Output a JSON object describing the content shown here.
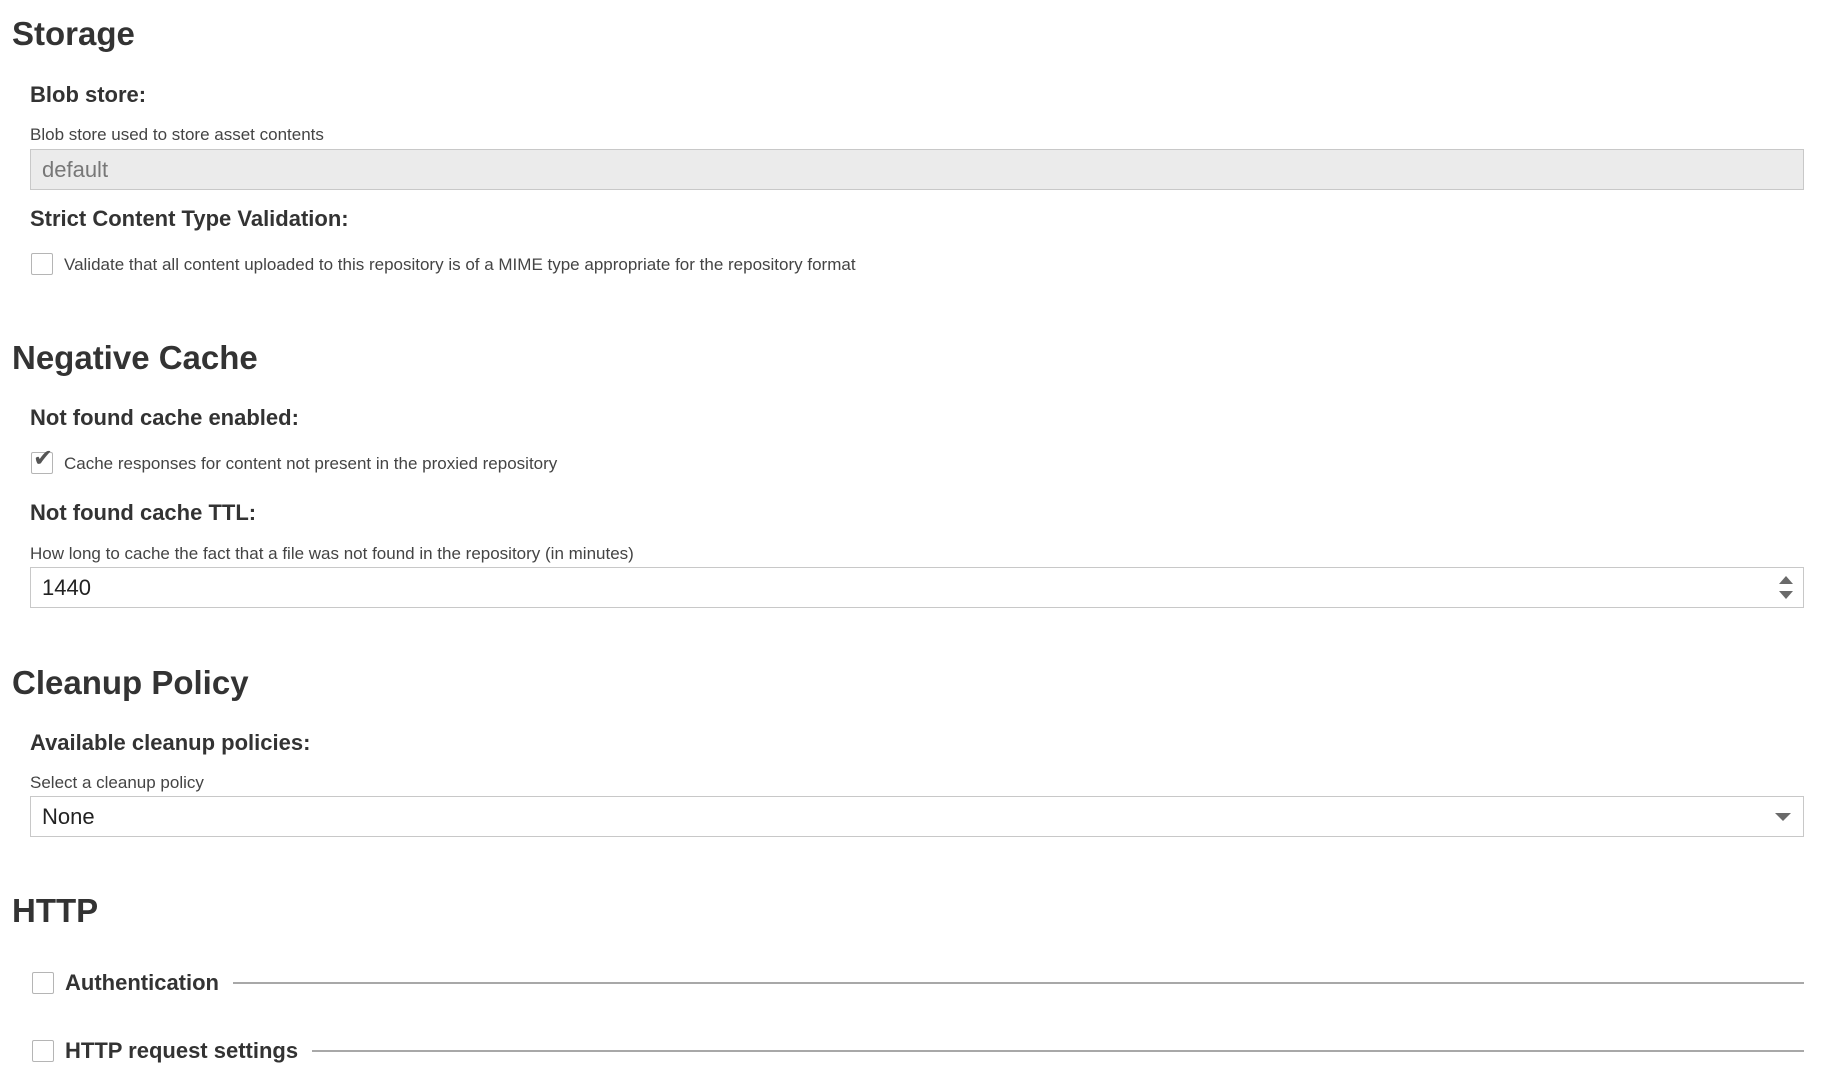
{
  "storage": {
    "title": "Storage",
    "blob_store": {
      "label": "Blob store:",
      "help": "Blob store used to store asset contents",
      "value": "default"
    },
    "strict_content": {
      "label": "Strict Content Type Validation:",
      "checkbox_label": "Validate that all content uploaded to this repository is of a MIME type appropriate for the repository format",
      "checked": false
    }
  },
  "negative_cache": {
    "title": "Negative Cache",
    "enabled": {
      "label": "Not found cache enabled:",
      "checkbox_label": "Cache responses for content not present in the proxied repository",
      "checked": true,
      "check_glyph": "✔"
    },
    "ttl": {
      "label": "Not found cache TTL:",
      "help": "How long to cache the fact that a file was not found in the repository (in minutes)",
      "value": "1440"
    }
  },
  "cleanup": {
    "title": "Cleanup Policy",
    "policies": {
      "label": "Available cleanup policies:",
      "help": "Select a cleanup policy",
      "selected": "None"
    }
  },
  "http": {
    "title": "HTTP",
    "authentication": {
      "label": "Authentication",
      "checked": false
    },
    "request_settings": {
      "label": "HTTP request settings",
      "checked": false
    }
  },
  "colors": {
    "text": "#333333",
    "readonly_bg": "#ebebeb",
    "border": "#c8c8c8"
  },
  "icons": {
    "spinner": "spinner-arrows-icon",
    "dropdown": "chevron-down-icon",
    "check": "checkmark-icon"
  }
}
